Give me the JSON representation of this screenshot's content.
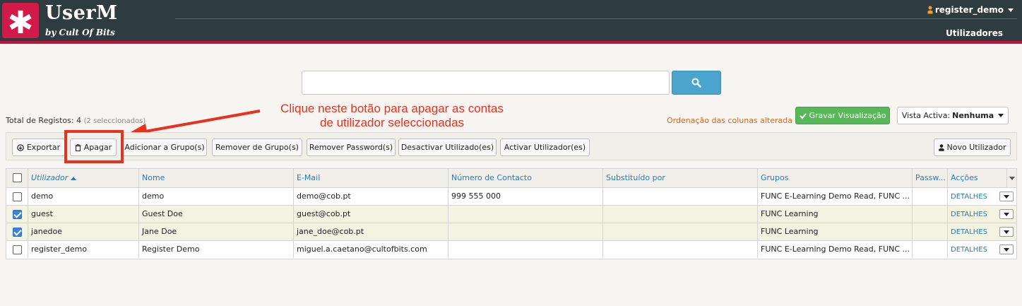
{
  "header": {
    "logo_glyph": "✱",
    "brand": "UserM",
    "brand_sub": "by Cult Of Bits",
    "user": "register_demo",
    "nav_users": "Utilizadores"
  },
  "search": {
    "value": "",
    "placeholder": ""
  },
  "status": {
    "total_label": "Total de Registos: 4",
    "selected_label": "(2 seleccionados)",
    "order_msg": "Ordenação das colunas alterada",
    "save_view": "Gravar Visualização",
    "view_label": "Vista Activa:",
    "view_value": "Nenhuma"
  },
  "annotation": {
    "line1": "Clique neste botão para apagar as contas",
    "line2": "de utilizador seleccionadas",
    "color": "#e8311e"
  },
  "toolbar": {
    "export": "Exportar",
    "delete": "Apagar",
    "add_group": "Adicionar a Grupo(s)",
    "remove_group": "Remover de Grupo(s)",
    "remove_password": "Remover Password(s)",
    "deactivate": "Desactivar Utilizado(es)",
    "activate": "Activar Utilizador(es)",
    "new_user": "Novo Utilizador"
  },
  "table": {
    "headers": {
      "user": "Utilizador",
      "name": "Nome",
      "email": "E-Mail",
      "contact": "Número de Contacto",
      "replaced": "Substituído por",
      "groups": "Grupos",
      "password": "Passw...",
      "actions": "Acções"
    },
    "rows": [
      {
        "checked": false,
        "user": "demo",
        "name": "demo",
        "email": "demo@cob.pt",
        "contact": "999 555 000",
        "replaced": "",
        "groups": "FUNC E-Learning Demo Read, FUNC ...",
        "password": "",
        "action": "DETALHES"
      },
      {
        "checked": true,
        "user": "guest",
        "name": "Guest Doe",
        "email": "guest@cob.pt",
        "contact": "",
        "replaced": "",
        "groups": "FUNC Learning",
        "password": "",
        "action": "DETALHES"
      },
      {
        "checked": true,
        "user": "janedoe",
        "name": "Jane Doe",
        "email": "jane_doe@cob.pt",
        "contact": "",
        "replaced": "",
        "groups": "FUNC Learning",
        "password": "",
        "action": "DETALHES"
      },
      {
        "checked": false,
        "user": "register_demo",
        "name": "Register Demo",
        "email": "miguel.a.caetano@cultofbits.com",
        "contact": "",
        "replaced": "",
        "groups": "FUNC E-Learning Demo Read, FUNC ...",
        "password": "",
        "action": "DETALHES"
      }
    ]
  },
  "colors": {
    "header_bg": "#2e3b3f",
    "accent_red": "#c2123f",
    "link_blue": "#2a7ab8",
    "success_green": "#58b758",
    "search_blue": "#4aa4cc",
    "warning_orange": "#d9651c"
  }
}
